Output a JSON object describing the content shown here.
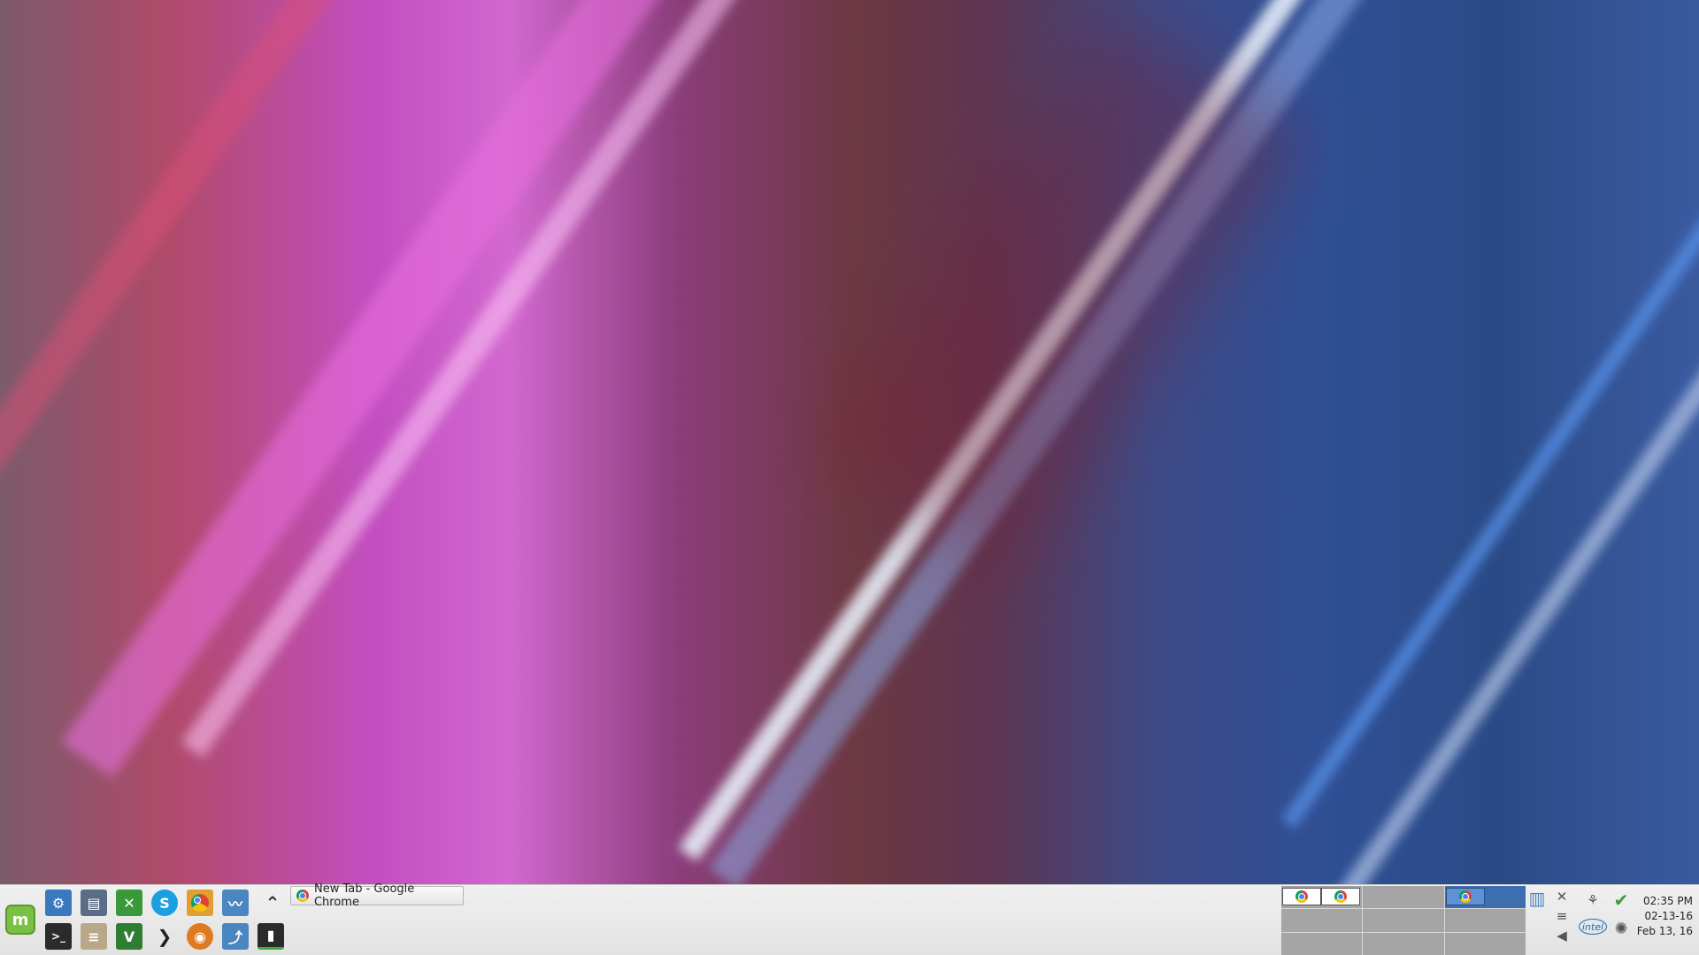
{
  "panel": {
    "menu_icon": "linux-mint-logo-icon",
    "launchers_top": [
      {
        "name": "system-settings-icon",
        "color": "#3a79c0"
      },
      {
        "name": "file-manager-icon",
        "color": "#5b6c86"
      },
      {
        "name": "spreadsheet-icon",
        "color": "#3a9a3a"
      },
      {
        "name": "skype-icon",
        "color": "#1aa0e0"
      },
      {
        "name": "chrome-icon",
        "color": "#e0a030"
      },
      {
        "name": "system-monitor-icon",
        "color": "#4a86c0"
      }
    ],
    "launchers_bottom": [
      {
        "name": "terminal-icon",
        "color": "#2b2b2b"
      },
      {
        "name": "text-editor-icon",
        "color": "#8a7a60"
      },
      {
        "name": "vim-icon",
        "color": "#2e7d32"
      },
      {
        "name": "prompt-arrow-icon",
        "color": "#222"
      },
      {
        "name": "firefox-icon",
        "color": "#e07a20"
      },
      {
        "name": "mysql-workbench-icon",
        "color": "#4a86c0"
      },
      {
        "name": "dark-app-icon",
        "color": "#2a2a2a"
      }
    ],
    "task": {
      "title": "New Tab - Google Chrome"
    },
    "clock": {
      "time": "02:35 PM",
      "date_short": "02-13-16",
      "date_long": "Feb 13, 16"
    }
  }
}
